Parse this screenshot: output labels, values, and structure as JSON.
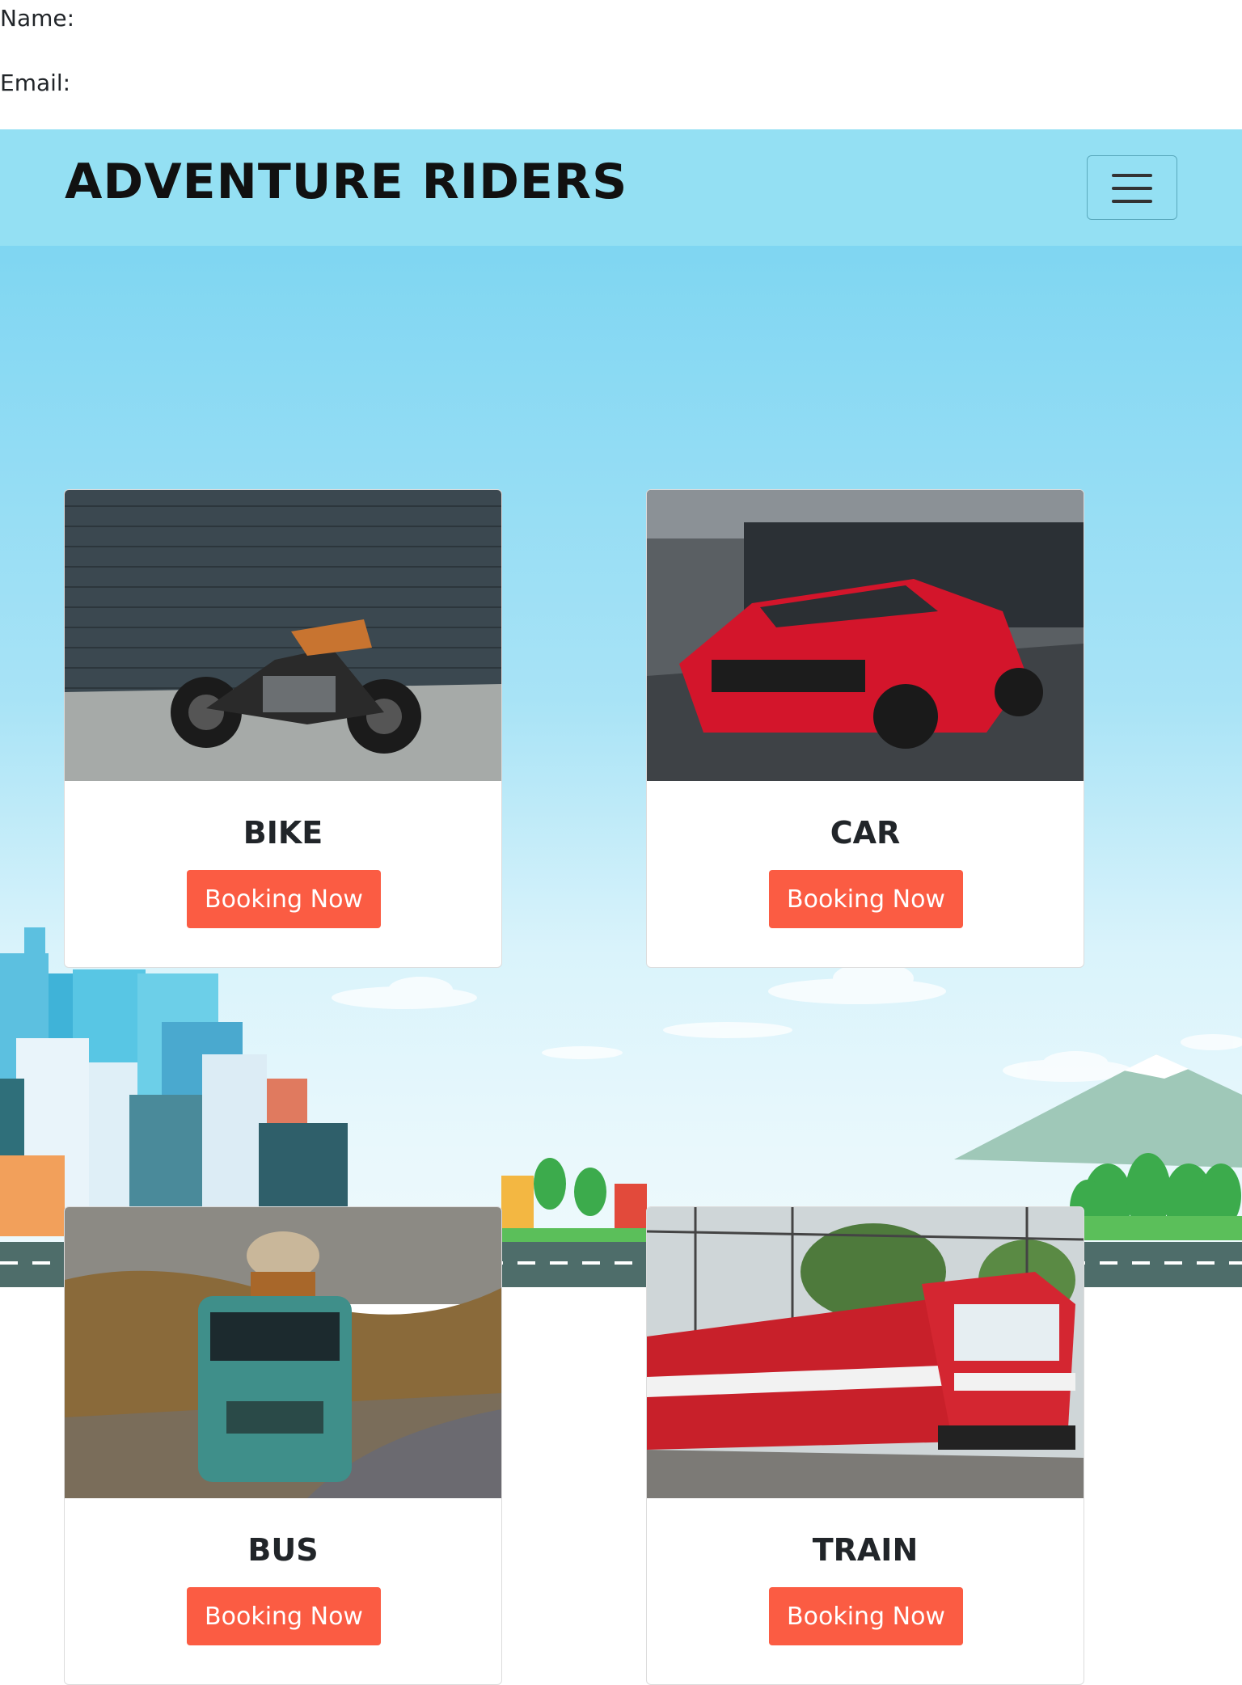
{
  "form": {
    "name_label": "Name:",
    "email_label": "Email:"
  },
  "navbar": {
    "brand": "ADVENTURE RIDERS",
    "toggler_icon": "hamburger-icon"
  },
  "cards": [
    {
      "title": "BIKE",
      "button": "Booking Now",
      "image": "motorcycle-photo"
    },
    {
      "title": "CAR",
      "button": "Booking Now",
      "image": "red-sports-car-photo"
    },
    {
      "title": "BUS",
      "button": "Booking Now",
      "image": "vintage-bus-photo"
    },
    {
      "title": "TRAIN",
      "button": "Booking Now",
      "image": "red-train-photo"
    }
  ],
  "colors": {
    "navbar": "#94e0f3",
    "button": "#fb5c43",
    "sky": "#a8e3f6"
  }
}
